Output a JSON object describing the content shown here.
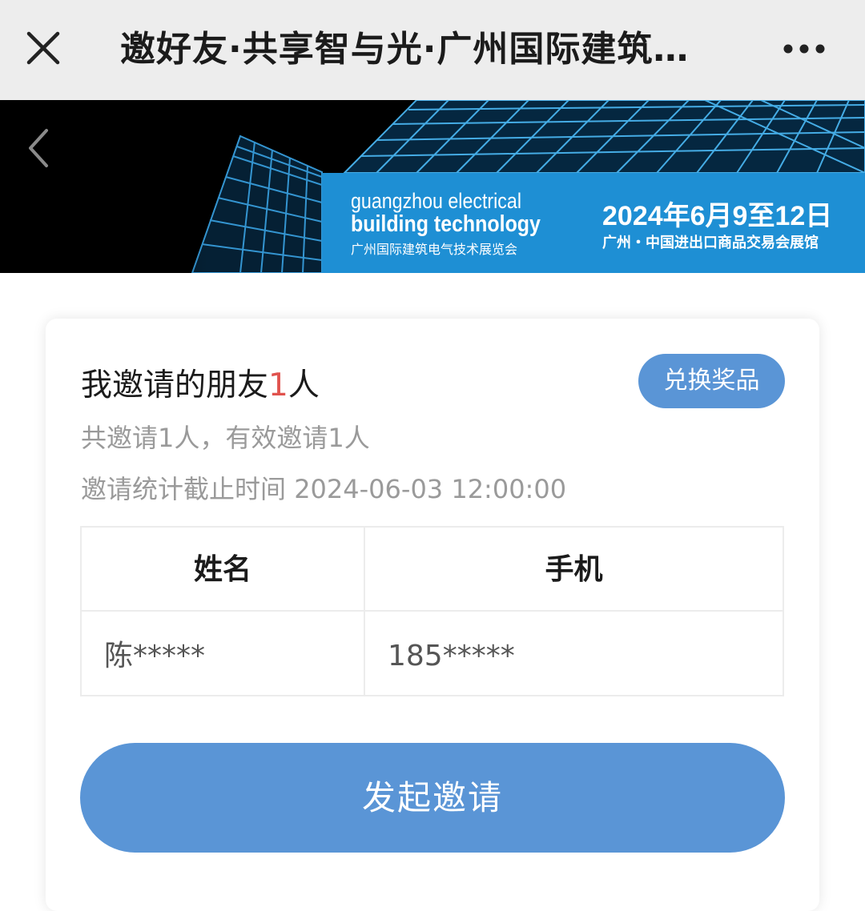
{
  "navbar": {
    "title": "邀好友·共享智与光·广州国际建筑…",
    "close_icon": "close-icon",
    "more_icon": "more-icon"
  },
  "banner": {
    "back_icon": "chevron-left-icon",
    "title_en_line1": "guangzhou electrical",
    "title_en_line2": "building technology",
    "title_cn": "广州国际建筑电气技术展览会",
    "date": "2024年6月9至12日",
    "venue": "广州・中国进出口商品交易会展馆",
    "accent_color": "#1e8fd4"
  },
  "invite_card": {
    "title_prefix": "我邀请的朋友",
    "title_count": "1",
    "title_suffix": "人",
    "redeem_label": "兑换奖品",
    "summary": "共邀请1人，有效邀请1人",
    "deadline_label": "邀请统计截止时间",
    "deadline_value": "2024-06-03 12:00:00",
    "table": {
      "headers": [
        "姓名",
        "手机"
      ],
      "rows": [
        [
          "陈*****",
          "185*****"
        ]
      ]
    },
    "invite_button_label": "发起邀请",
    "button_color": "#5a95d6",
    "count_color": "#e0524d"
  }
}
